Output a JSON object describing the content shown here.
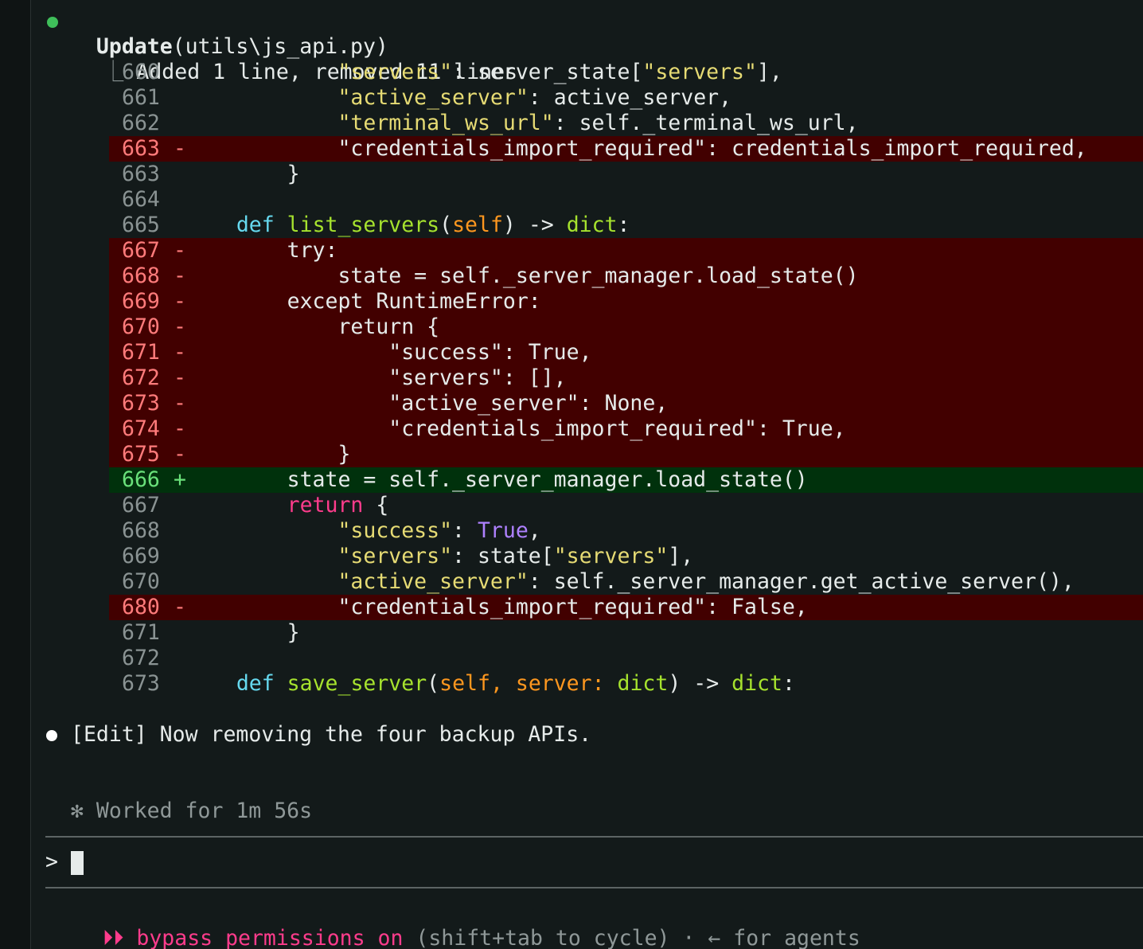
{
  "tool_call": {
    "name": "Update",
    "args": "(utils\\js_api.py)",
    "status_color": "#3fbf5a",
    "summary": "Added 1 line, removed 11 lines",
    "connector": "⎿"
  },
  "diff_rows": [
    {
      "type": "ctx",
      "ln": "660",
      "tokens": [
        [
          "",
          "            "
        ],
        [
          "str",
          "\"servers\""
        ],
        [
          "",
          ": server_state["
        ],
        [
          "str",
          "\"servers\""
        ],
        [
          "",
          "],"
        ]
      ]
    },
    {
      "type": "ctx",
      "ln": "661",
      "tokens": [
        [
          "",
          "            "
        ],
        [
          "str",
          "\"active_server\""
        ],
        [
          "",
          ": active_server,"
        ]
      ]
    },
    {
      "type": "ctx",
      "ln": "662",
      "tokens": [
        [
          "",
          "            "
        ],
        [
          "str",
          "\"terminal_ws_url\""
        ],
        [
          "",
          ": self._terminal_ws_url,"
        ]
      ]
    },
    {
      "type": "del",
      "ln": "663",
      "tokens": [
        [
          "",
          "            \"credentials_import_required\": credentials_import_required,"
        ]
      ]
    },
    {
      "type": "ctx",
      "ln": "663",
      "tokens": [
        [
          "",
          "        }"
        ]
      ]
    },
    {
      "type": "ctx",
      "ln": "664",
      "tokens": []
    },
    {
      "type": "ctx",
      "ln": "665",
      "tokens": [
        [
          "",
          "    "
        ],
        [
          "def",
          "def"
        ],
        [
          "",
          " "
        ],
        [
          "fn",
          "list_servers"
        ],
        [
          "",
          "("
        ],
        [
          "self",
          "self"
        ],
        [
          "",
          ") -> "
        ],
        [
          "type",
          "dict"
        ],
        [
          "",
          ":"
        ]
      ]
    },
    {
      "type": "del",
      "ln": "667",
      "tokens": [
        [
          "",
          "        try:"
        ]
      ]
    },
    {
      "type": "del",
      "ln": "668",
      "tokens": [
        [
          "",
          "            state = self._server_manager.load_state()"
        ]
      ]
    },
    {
      "type": "del",
      "ln": "669",
      "tokens": [
        [
          "",
          "        except RuntimeError:"
        ]
      ]
    },
    {
      "type": "del",
      "ln": "670",
      "tokens": [
        [
          "",
          "            return {"
        ]
      ]
    },
    {
      "type": "del",
      "ln": "671",
      "tokens": [
        [
          "",
          "                \"success\": True,"
        ]
      ]
    },
    {
      "type": "del",
      "ln": "672",
      "tokens": [
        [
          "",
          "                \"servers\": [],"
        ]
      ]
    },
    {
      "type": "del",
      "ln": "673",
      "tokens": [
        [
          "",
          "                \"active_server\": None,"
        ]
      ]
    },
    {
      "type": "del",
      "ln": "674",
      "tokens": [
        [
          "",
          "                \"credentials_import_required\": True,"
        ]
      ]
    },
    {
      "type": "del",
      "ln": "675",
      "tokens": [
        [
          "",
          "            }"
        ]
      ]
    },
    {
      "type": "add",
      "ln": "666",
      "tokens": [
        [
          "",
          "        state = self._server_manager.load_state()"
        ]
      ]
    },
    {
      "type": "ctx",
      "ln": "667",
      "tokens": [
        [
          "",
          "        "
        ],
        [
          "kw",
          "return"
        ],
        [
          "",
          " {"
        ]
      ]
    },
    {
      "type": "ctx",
      "ln": "668",
      "tokens": [
        [
          "",
          "            "
        ],
        [
          "str",
          "\"success\""
        ],
        [
          "",
          ": "
        ],
        [
          "bool",
          "True"
        ],
        [
          "",
          ","
        ]
      ]
    },
    {
      "type": "ctx",
      "ln": "669",
      "tokens": [
        [
          "",
          "            "
        ],
        [
          "str",
          "\"servers\""
        ],
        [
          "",
          ": state["
        ],
        [
          "str",
          "\"servers\""
        ],
        [
          "",
          "],"
        ]
      ]
    },
    {
      "type": "ctx",
      "ln": "670",
      "tokens": [
        [
          "",
          "            "
        ],
        [
          "str",
          "\"active_server\""
        ],
        [
          "",
          ": self._server_manager.get_active_server(),"
        ]
      ]
    },
    {
      "type": "del",
      "ln": "680",
      "tokens": [
        [
          "",
          "            \"credentials_import_required\": False,"
        ]
      ]
    },
    {
      "type": "ctx",
      "ln": "671",
      "tokens": [
        [
          "",
          "        }"
        ]
      ]
    },
    {
      "type": "ctx",
      "ln": "672",
      "tokens": []
    },
    {
      "type": "ctx",
      "ln": "673",
      "tokens": [
        [
          "",
          "    "
        ],
        [
          "def",
          "def"
        ],
        [
          "",
          " "
        ],
        [
          "fn",
          "save_server"
        ],
        [
          "",
          "("
        ],
        [
          "self",
          "self, server: "
        ],
        [
          "type",
          "dict"
        ],
        [
          "",
          ") -> "
        ],
        [
          "type",
          "dict"
        ],
        [
          "",
          ":"
        ]
      ]
    }
  ],
  "diff_markers": {
    "del": "-",
    "add": "+",
    "ctx": ""
  },
  "message": {
    "text": "[Edit] Now removing the four backup APIs.",
    "dot_color": "#ffffff"
  },
  "worked": {
    "icon": "✻",
    "text": "Worked for 1m 56s"
  },
  "prompt": {
    "symbol": ">"
  },
  "footer": {
    "icon": "⏵⏵",
    "mode": "bypass permissions on",
    "hint": " (shift+tab to cycle) · ← for agents",
    "accent": "#ff3c8c"
  }
}
